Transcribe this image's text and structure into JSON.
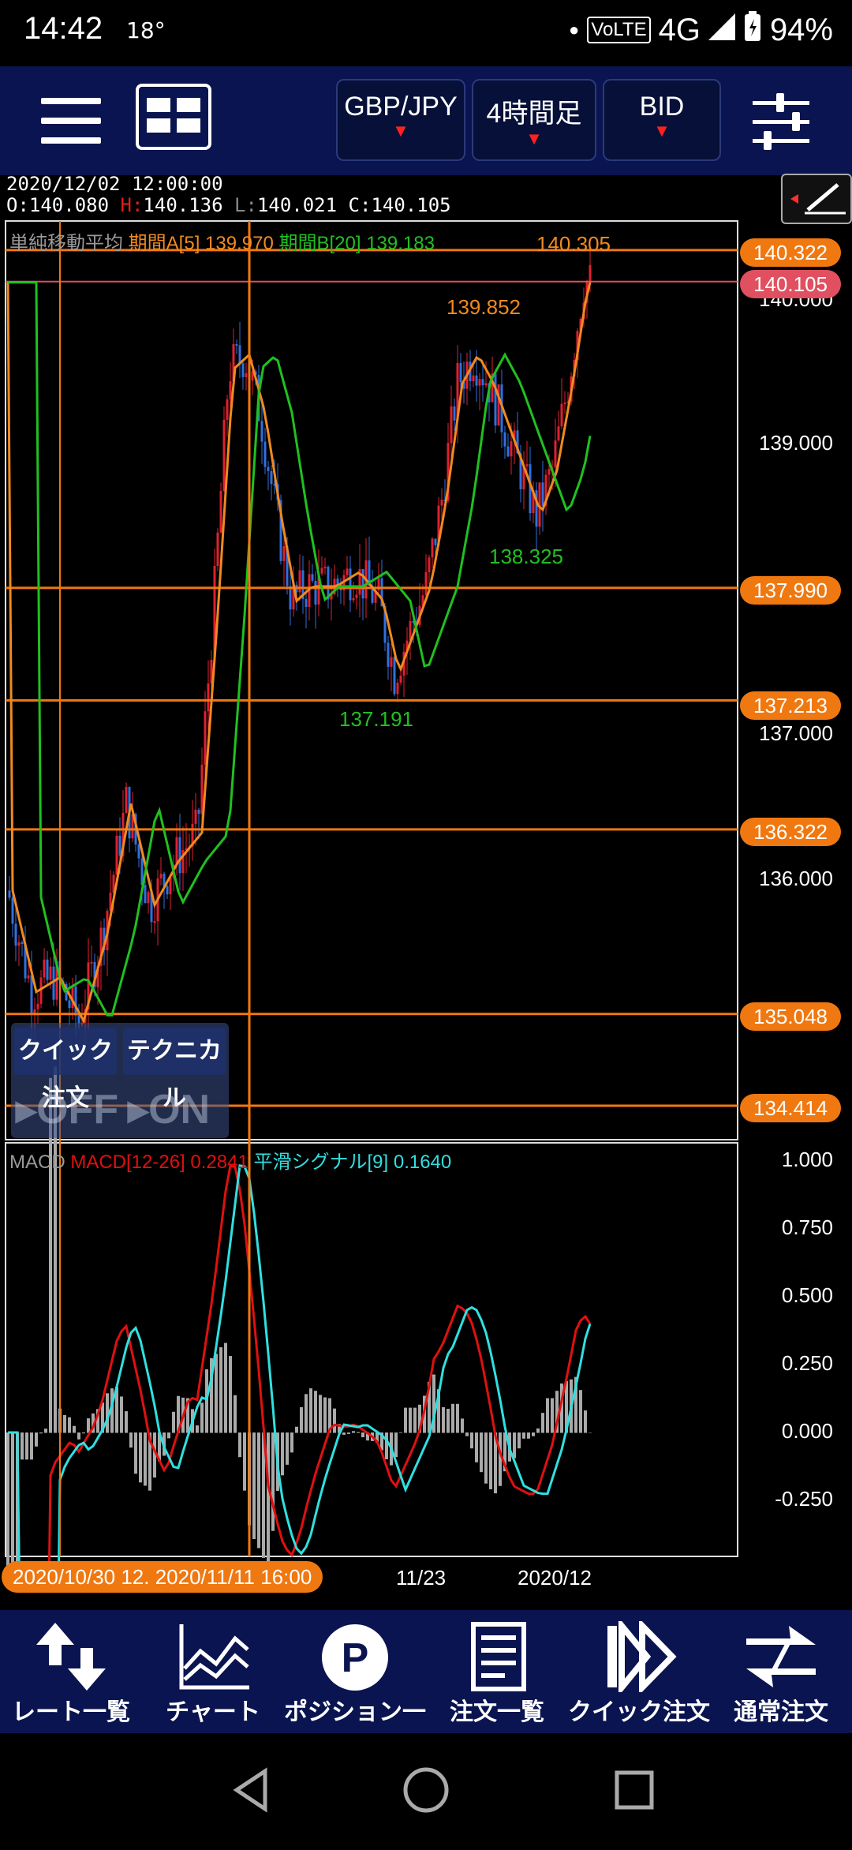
{
  "status": {
    "time": "14:42",
    "temp": "18°",
    "volte": "VoLTE",
    "network": "4G",
    "battery": "94%"
  },
  "toolbar": {
    "pair": "GBP/JPY",
    "timeframe": "4時間足",
    "price_type": "BID"
  },
  "info": {
    "datetime": "2020/12/02 12:00:00",
    "open_label": "O:",
    "open": "140.080",
    "high_label": "H:",
    "high": "140.136",
    "low_label": "L:",
    "low": "140.021",
    "close_label": "C:",
    "close": "140.105"
  },
  "legend": {
    "sma_label": "単純移動平均",
    "period_a": "期間A[5]",
    "period_a_value": "139.970",
    "period_b": "期間B[20]",
    "period_b_value": "139.183",
    "macd_label": "MACD",
    "macd_param": "MACD[12-26]",
    "macd_value": "0.2841",
    "signal_param": "平滑シグナル[9]",
    "signal_value": "0.1640"
  },
  "price_lines": [
    {
      "value": "140.322",
      "color": "#f07810"
    },
    {
      "value": "140.105",
      "color": "#e05060"
    },
    {
      "value": "137.990",
      "color": "#f07810"
    },
    {
      "value": "137.213",
      "color": "#f07810"
    },
    {
      "value": "136.322",
      "color": "#f07810"
    },
    {
      "value": "135.048",
      "color": "#f07810"
    },
    {
      "value": "134.414",
      "color": "#f07810"
    }
  ],
  "price_axis": [
    "140.000",
    "139.000",
    "137.000",
    "136.000"
  ],
  "macd_axis": [
    "1.000",
    "0.750",
    "0.500",
    "0.250",
    "0.000",
    "-0.250"
  ],
  "annotations": {
    "high1": "140.305",
    "swing": "139.852",
    "low_green": "138.325",
    "low_green2": "137.191"
  },
  "overlay": {
    "quick_order": "クイック注文",
    "technical": "テクニカル",
    "quick_state": "OFF",
    "tech_state": "ON"
  },
  "dates": {
    "pill": "2020/10/30 12. 2020/11/11 16:00",
    "d1": "11/23",
    "d2": "2020/12"
  },
  "nav": [
    "レート一覧",
    "チャート",
    "ポジション一覧",
    "注文一覧",
    "クイック注文",
    "通常注文"
  ],
  "colors": {
    "accent": "#f07810",
    "candle_up": "#e02030",
    "candle_down": "#3070e0",
    "ma_a": "#f08a20",
    "ma_b": "#20c020",
    "macd": "#e01010",
    "signal": "#30e0e0",
    "nav_bg": "#0a1450"
  }
}
